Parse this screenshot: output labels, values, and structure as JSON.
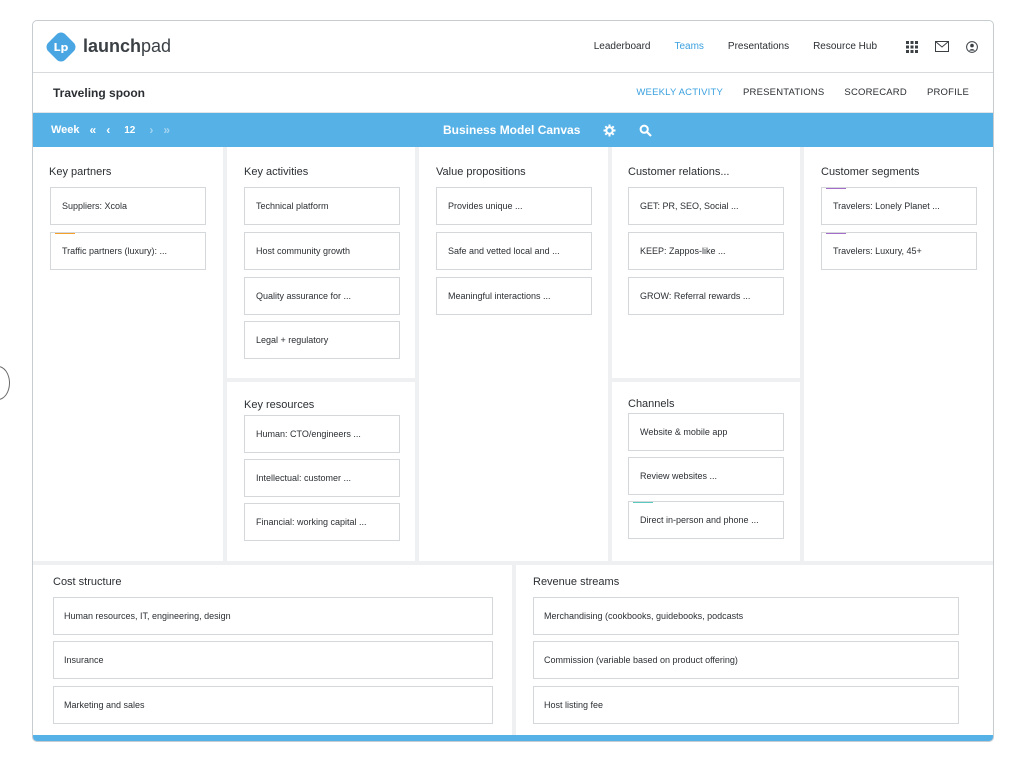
{
  "brand": {
    "name_bold": "launch",
    "name_regular": "pad",
    "mark": "Lp",
    "accent": "#56b1e6"
  },
  "topnav": {
    "links": [
      {
        "label": "Leaderboard",
        "active": false
      },
      {
        "label": "Teams",
        "active": true
      },
      {
        "label": "Presentations",
        "active": false
      },
      {
        "label": "Resource Hub",
        "active": false
      }
    ],
    "icons": [
      "grid-icon",
      "mail-icon",
      "user-icon"
    ]
  },
  "project": {
    "title": "Traveling spoon",
    "tabs": [
      {
        "label": "WEEKLY ACTIVITY",
        "active": true
      },
      {
        "label": "PRESENTATIONS",
        "active": false
      },
      {
        "label": "SCORECARD",
        "active": false
      },
      {
        "label": "PROFILE",
        "active": false
      }
    ]
  },
  "toolbar": {
    "week_label": "Week",
    "week_number": "12",
    "canvas_title": "Business Model Canvas",
    "icons": [
      "gear-icon",
      "search-icon"
    ]
  },
  "canvas": {
    "key_partners": {
      "title": "Key partners",
      "cards": [
        {
          "text": "Suppliers: Xcola",
          "tag": null
        },
        {
          "text": "Traffic partners (luxury): ...",
          "tag": "#f5a02a"
        }
      ]
    },
    "key_activities": {
      "title": "Key activities",
      "cards": [
        {
          "text": "Technical platform",
          "tag": null
        },
        {
          "text": "Host community growth",
          "tag": null
        },
        {
          "text": "Quality assurance for ...",
          "tag": null
        },
        {
          "text": "Legal + regulatory",
          "tag": null
        }
      ]
    },
    "key_resources": {
      "title": "Key resources",
      "cards": [
        {
          "text": "Human: CTO/engineers ...",
          "tag": null
        },
        {
          "text": "Intellectual: customer ...",
          "tag": null
        },
        {
          "text": "Financial: working capital ...",
          "tag": null
        }
      ]
    },
    "value_propositions": {
      "title": "Value propositions",
      "cards": [
        {
          "text": "Provides unique ...",
          "tag": null
        },
        {
          "text": "Safe and vetted local and ...",
          "tag": null
        },
        {
          "text": "Meaningful interactions ...",
          "tag": null
        }
      ]
    },
    "customer_relations": {
      "title": "Customer relations...",
      "cards": [
        {
          "text": "GET: PR, SEO, Social ...",
          "tag": null
        },
        {
          "text": "KEEP: Zappos-like ...",
          "tag": null
        },
        {
          "text": "GROW: Referral rewards ...",
          "tag": null
        }
      ]
    },
    "channels": {
      "title": "Channels",
      "cards": [
        {
          "text": "Website & mobile app",
          "tag": null
        },
        {
          "text": "Review websites ...",
          "tag": null
        },
        {
          "text": "Direct in-person and phone ...",
          "tag": "#5bc9bf"
        }
      ]
    },
    "customer_segments": {
      "title": "Customer segments",
      "cards": [
        {
          "text": "Travelers: Lonely Planet ...",
          "tag": "#a56dc8"
        },
        {
          "text": "Travelers: Luxury, 45+",
          "tag": "#a56dc8"
        }
      ]
    },
    "cost_structure": {
      "title": "Cost structure",
      "cards": [
        {
          "text": "Human resources, IT, engineering, design"
        },
        {
          "text": "Insurance"
        },
        {
          "text": "Marketing and sales"
        }
      ]
    },
    "revenue_streams": {
      "title": "Revenue streams",
      "cards": [
        {
          "text": "Merchandising (cookbooks, guidebooks, podcasts"
        },
        {
          "text": "Commission (variable based on product offering)"
        },
        {
          "text": "Host listing fee"
        }
      ]
    }
  }
}
